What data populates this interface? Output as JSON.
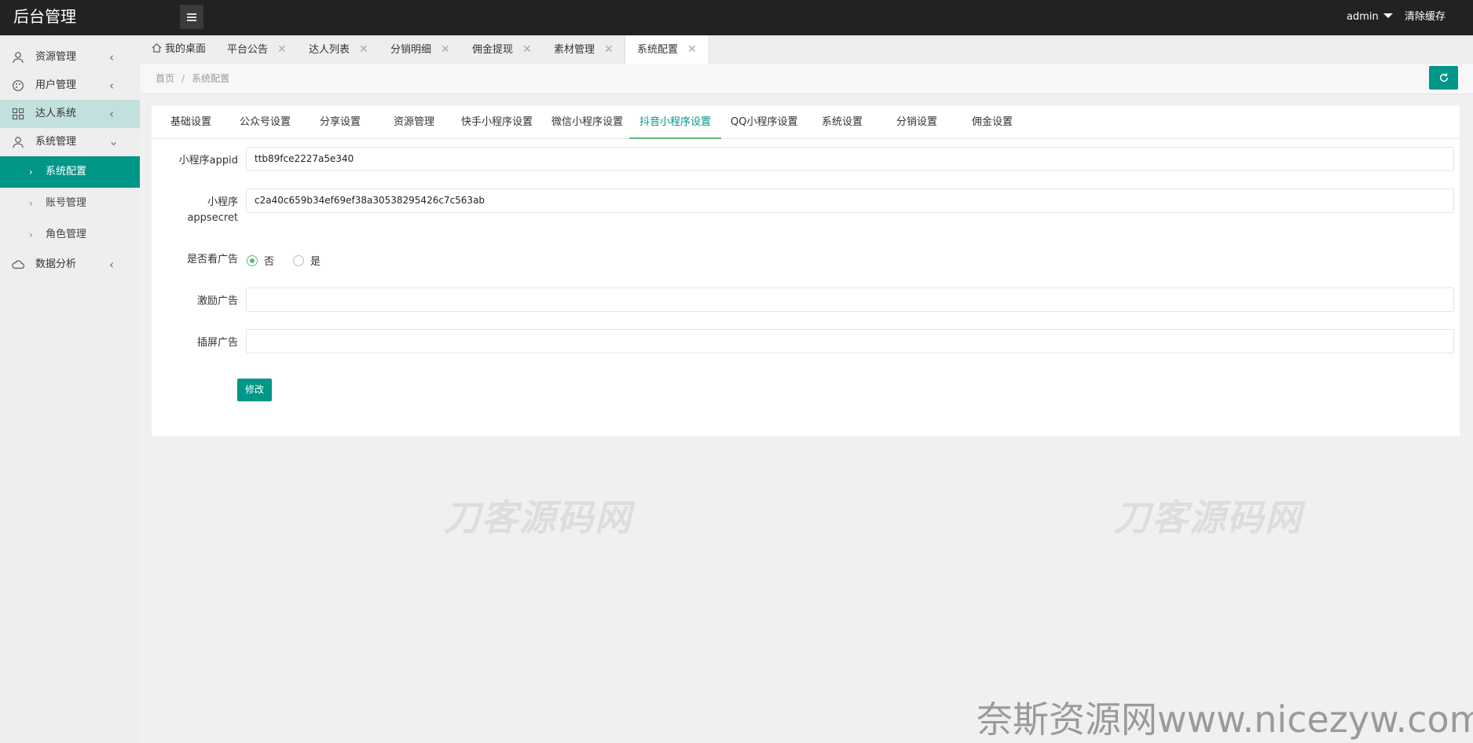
{
  "header": {
    "brand": "后台管理",
    "user": "admin",
    "clear_cache": "清除缓存"
  },
  "sidebar": {
    "items": [
      {
        "label": "资源管理",
        "icon": "user-icon"
      },
      {
        "label": "用户管理",
        "icon": "palette-icon"
      },
      {
        "label": "达人系统",
        "icon": "grid-icon"
      },
      {
        "label": "系统管理",
        "icon": "user-icon"
      },
      {
        "label": "数据分析",
        "icon": "cloud-icon"
      }
    ],
    "sub_items": [
      {
        "label": "系统配置"
      },
      {
        "label": "账号管理"
      },
      {
        "label": "角色管理"
      }
    ]
  },
  "tabs": [
    {
      "label": "我的桌面"
    },
    {
      "label": "平台公告"
    },
    {
      "label": "达人列表"
    },
    {
      "label": "分销明细"
    },
    {
      "label": "佣金提现"
    },
    {
      "label": "素材管理"
    },
    {
      "label": "系统配置"
    }
  ],
  "breadcrumb": {
    "home": "首页",
    "sep": "/",
    "current": "系统配置"
  },
  "config_tabs": [
    {
      "label": "基础设置"
    },
    {
      "label": "公众号设置"
    },
    {
      "label": "分享设置"
    },
    {
      "label": "资源管理"
    },
    {
      "label": "快手小程序设置"
    },
    {
      "label": "微信小程序设置"
    },
    {
      "label": "抖音小程序设置"
    },
    {
      "label": "QQ小程序设置"
    },
    {
      "label": "系统设置"
    },
    {
      "label": "分销设置"
    },
    {
      "label": "佣金设置"
    }
  ],
  "form": {
    "appid": {
      "label": "小程序appid",
      "value": "ttb89fce2227a5e340"
    },
    "appsecret": {
      "label_1": "小程序",
      "label_2": "appsecret",
      "value": "c2a40c659b34ef69ef38a30538295426c7c563ab"
    },
    "watch_ad": {
      "label": "是否看广告",
      "options": [
        "否",
        "是"
      ],
      "selected": "否"
    },
    "reward_ad": {
      "label": "激励广告",
      "value": ""
    },
    "interstitial_ad": {
      "label": "插屏广告",
      "value": ""
    },
    "submit": "修改"
  },
  "watermarks": {
    "center": "刀客源码网",
    "corner": "奈斯资源网www.nicezyw.com"
  },
  "colors": {
    "accent": "#009688",
    "active_tab_underline": "#5fb878",
    "topbar": "#222222"
  }
}
